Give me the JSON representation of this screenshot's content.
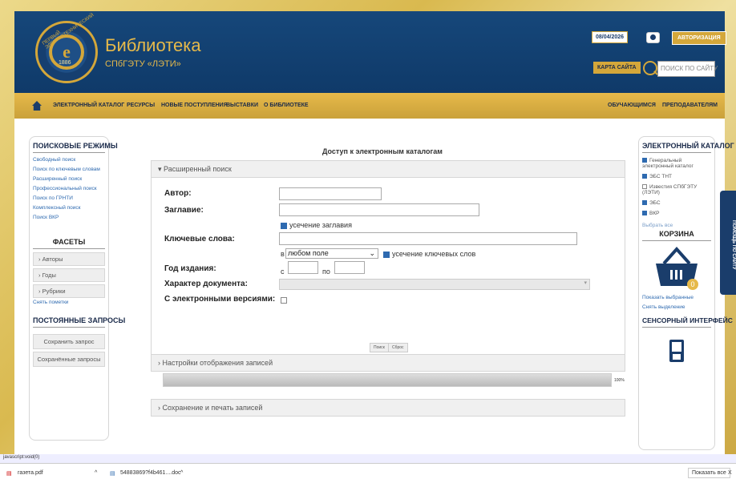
{
  "header": {
    "title": "Библиотека",
    "subtitle": "СПбГЭТУ «ЛЭТИ»",
    "logo_year": "1886",
    "logo_arc": "ПЕРВЫЙ ЭЛЕКТРОТЕХНИЧЕСКИЙ",
    "date": "08/04/2026",
    "auth": "АВТОРИЗАЦИЯ",
    "sitemap": "КАРТА САЙТА",
    "search_placeholder": "ПОИСК ПО САЙТУ"
  },
  "nav": {
    "items": [
      "ЭЛЕКТРОННЫЙ КАТАЛОГ",
      "РЕСУРСЫ",
      "НОВЫЕ ПОСТУПЛЕНИЯ",
      "ВЫСТАВКИ",
      "О БИБЛИОТЕКЕ"
    ],
    "right": [
      "ОБУЧАЮЩИМСЯ",
      "ПРЕПОДАВАТЕЛЯМ"
    ]
  },
  "left": {
    "modes_title": "ПОИСКОВЫЕ РЕЖИМЫ",
    "modes": [
      "Свободный поиск",
      "Поиск по ключевым словам",
      "Расширенный поиск",
      "Профессиональный поиск",
      "Поиск по ГРНТИ",
      "Комплексный поиск",
      "Поиск ВКР"
    ],
    "facets_title": "ФАСЕТЫ",
    "facets": [
      "› Авторы",
      "› Годы",
      "› Рубрики"
    ],
    "clear": "Снять пометки",
    "queries_title": "ПОСТОЯННЫЕ ЗАПРОСЫ",
    "save": "Сохранить запрос",
    "saved": "Сохранённые запросы"
  },
  "main": {
    "title": "Доступ к электронным каталогам",
    "adv": "▾ Расширенный поиск",
    "author": "Автор:",
    "titlel": "Заглавие:",
    "trunc_title": "усечение заглавия",
    "keywords": "Ключевые слова:",
    "in": "в",
    "field": "любом поле",
    "trunc_kw": "усечение ключевых слов",
    "year": "Год издания:",
    "from": "с",
    "to": "по",
    "doctype": "Характер документа:",
    "electronic": "С электронными версиями:",
    "search_btn": "Поиск",
    "reset_btn": "Сброс",
    "display": "› Настройки отображения записей",
    "progress_label": "100%",
    "progress": 1.0,
    "saveprint": "› Сохранение и печать записей"
  },
  "right": {
    "cat_title": "ЭЛЕКТРОННЫЙ КАТАЛОГ",
    "cats": [
      {
        "label": "Генеральный электронный каталог",
        "on": true
      },
      {
        "label": "ЭБС ТНТ",
        "on": true
      },
      {
        "label": "Известия СПбГЭТУ (ЛЭТИ)",
        "on": false
      },
      {
        "label": "ЭБС",
        "on": true
      },
      {
        "label": "ВКР",
        "on": true
      }
    ],
    "select_all": "Выбрать все",
    "cart_title": "КОРЗИНА",
    "cart_count": "0",
    "show_sel": "Показать выбранные",
    "clear_sel": "Снять выделение",
    "touch_title": "СЕНСОРНЫЙ ИНТЕРФЕЙС"
  },
  "help": "ПОМОЩЬ ПО САЙТУ",
  "status": "javascript:void(0)",
  "downloads": {
    "file1": "газета.pdf",
    "file2": "54883869?f4b461....doc",
    "show_all": "Показать все",
    "close": "X"
  }
}
